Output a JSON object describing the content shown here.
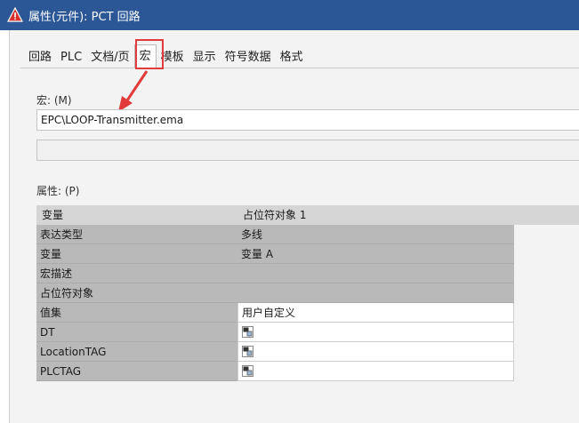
{
  "window": {
    "title": "属性(元件): PCT 回路"
  },
  "tabs": [
    {
      "label": "回路"
    },
    {
      "label": "PLC"
    },
    {
      "label": "文档/页"
    },
    {
      "label": "宏"
    },
    {
      "label": "模板"
    },
    {
      "label": "显示"
    },
    {
      "label": "符号数据"
    },
    {
      "label": "格式"
    }
  ],
  "active_tab": "宏",
  "macro": {
    "label": "宏: (M)",
    "value": "EPC\\LOOP-Transmitter.ema",
    "secondary_value": ""
  },
  "properties": {
    "label": "属性: (P)",
    "header": {
      "col1": "变量",
      "col2": "占位符对象 1"
    },
    "rows": [
      {
        "name": "表达类型",
        "value": "多线"
      },
      {
        "name": "变量",
        "value": "变量 A"
      },
      {
        "name": "宏描述",
        "value": ""
      },
      {
        "name": "占位符对象",
        "value": ""
      },
      {
        "name": "值集",
        "value": "用户自定义"
      },
      {
        "name": "DT",
        "value": ""
      },
      {
        "name": "LocationTAG",
        "value": ""
      },
      {
        "name": "PLCTAG",
        "value": ""
      }
    ]
  },
  "colors": {
    "titlebar": "#2b5797",
    "highlight": "#e23b3b"
  },
  "icons": {
    "app": "warning-triangle-icon",
    "cell": "property-editor-icon",
    "annotation": "arrow-icon"
  }
}
